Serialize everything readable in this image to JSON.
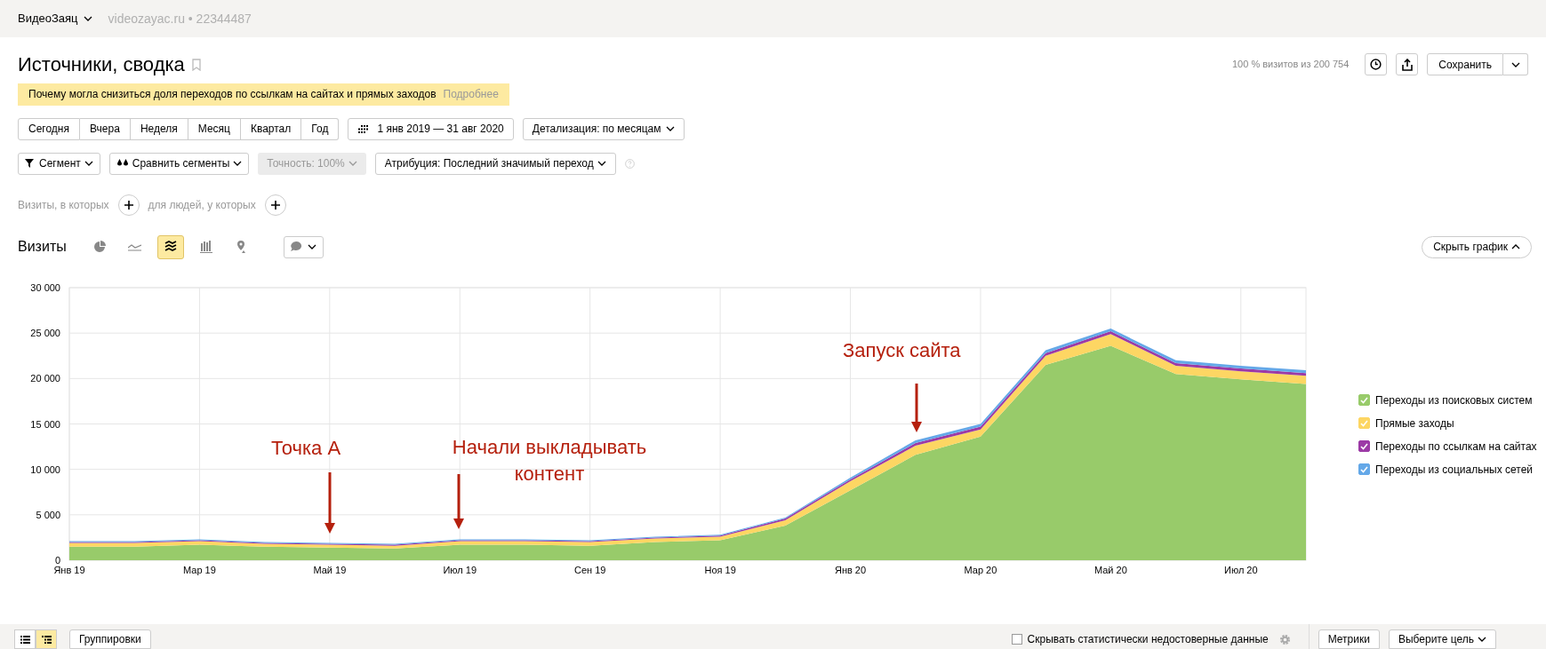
{
  "top_bar": {
    "account": "ВидеоЗаяц",
    "site": "videozayac.ru • 22344487"
  },
  "header": {
    "title": "Источники, сводка",
    "visits_share": "100 % визитов из 200 754",
    "save_button": "Сохранить"
  },
  "notice": {
    "text": "Почему могла снизиться доля переходов по ссылкам на сайтах и прямых заходов",
    "link": "Подробнее"
  },
  "periods": [
    {
      "label": "Сегодня",
      "selected": false
    },
    {
      "label": "Вчера",
      "selected": false
    },
    {
      "label": "Неделя",
      "selected": false
    },
    {
      "label": "Месяц",
      "selected": false
    },
    {
      "label": "Квартал",
      "selected": false
    },
    {
      "label": "Год",
      "selected": false
    }
  ],
  "date_range": "1 янв 2019 — 31 авг 2020",
  "detail": "Детализация: по месяцам",
  "filters": {
    "segment": "Сегмент",
    "compare": "Сравнить сегменты",
    "accuracy": "Точность: 100%",
    "attribution": "Атрибуция: Последний значимый переход"
  },
  "conditions": {
    "visits": "Визиты, в которых",
    "people": "для людей, у которых"
  },
  "chart_header": {
    "title": "Визиты",
    "hide_button": "Скрыть график",
    "chart_types": [
      {
        "kind": "pie",
        "selected": false
      },
      {
        "kind": "line",
        "selected": false
      },
      {
        "kind": "area",
        "selected": true
      },
      {
        "kind": "bar",
        "selected": false
      },
      {
        "kind": "map",
        "selected": false
      }
    ]
  },
  "chart_data": {
    "type": "area",
    "stacked": true,
    "categories": [
      "Янв 19",
      null,
      "Мар 19",
      null,
      "Май 19",
      null,
      "Июл 19",
      null,
      "Сен 19",
      null,
      "Ноя 19",
      null,
      "Янв 20",
      null,
      "Мар 20",
      null,
      "Май 20",
      null,
      "Июл 20",
      null
    ],
    "ylim": [
      0,
      30000
    ],
    "grid": true,
    "yticks": [
      {
        "value": 0,
        "label": "0"
      },
      {
        "value": 5000,
        "label": "5 000"
      },
      {
        "value": 10000,
        "label": "10 000"
      },
      {
        "value": 15000,
        "label": "15 000"
      },
      {
        "value": 20000,
        "label": "20 000"
      },
      {
        "value": 25000,
        "label": "25 000"
      },
      {
        "value": 30000,
        "label": "30 000"
      }
    ],
    "series": [
      {
        "name": "Переходы из поисковых систем",
        "color": "#98cb6a",
        "values": [
          1500,
          1500,
          1700,
          1500,
          1400,
          1300,
          1700,
          1700,
          1600,
          2000,
          2200,
          3800,
          7700,
          11600,
          13600,
          21500,
          23600,
          20500,
          19900,
          19400
        ]
      },
      {
        "name": "Прямые заходы",
        "color": "#fdd663",
        "values": [
          400,
          400,
          400,
          300,
          300,
          300,
          400,
          400,
          400,
          400,
          400,
          600,
          1000,
          1000,
          800,
          1000,
          1300,
          900,
          900,
          900
        ]
      },
      {
        "name": "Переходы по ссылкам на сайтах",
        "color": "#9c3aa6",
        "values": [
          100,
          100,
          100,
          100,
          100,
          100,
          100,
          100,
          100,
          100,
          100,
          200,
          200,
          300,
          300,
          300,
          300,
          300,
          300,
          300
        ]
      },
      {
        "name": "Переходы из социальных сетей",
        "color": "#64a8e8",
        "values": [
          100,
          100,
          100,
          100,
          100,
          100,
          100,
          100,
          100,
          100,
          100,
          100,
          200,
          300,
          300,
          300,
          300,
          300,
          300,
          300
        ]
      }
    ],
    "annotations": [
      "Точка А",
      "Начали выкладывать контент",
      "Запуск сайта"
    ]
  },
  "legend": [
    {
      "checked": true
    },
    {
      "checked": true
    },
    {
      "checked": true
    },
    {
      "checked": true
    }
  ],
  "bottom_bar": {
    "views": [
      {
        "kind": "list",
        "selected": false
      },
      {
        "kind": "tree",
        "selected": true
      }
    ],
    "groupings": "Группировки",
    "hide_unreliable": {
      "label": "Скрывать статистически недостоверные данные",
      "checked": false
    },
    "metrics": "Метрики",
    "goal": "Выберите цель"
  }
}
